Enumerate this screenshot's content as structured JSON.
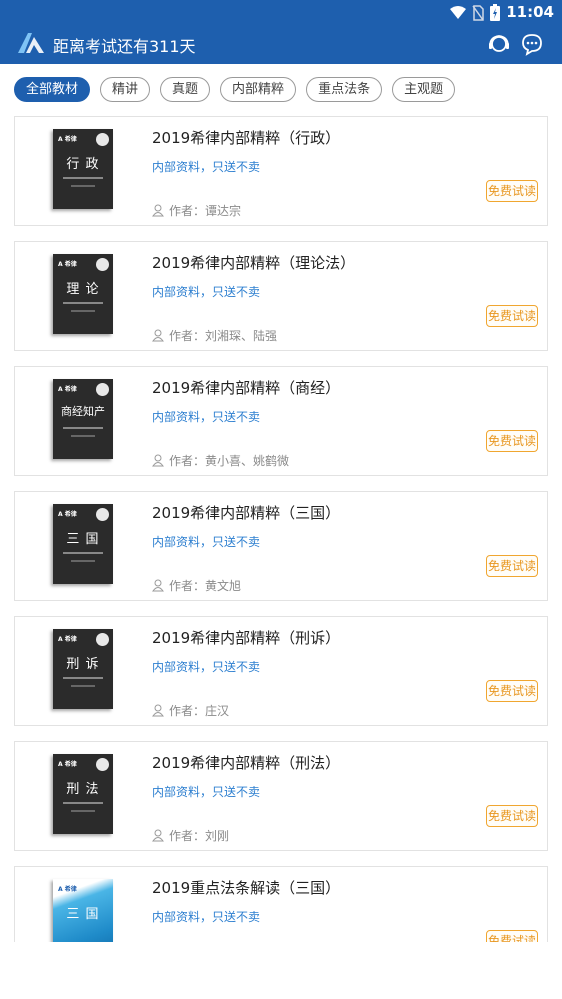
{
  "status_bar": {
    "time": "11:04"
  },
  "app_bar": {
    "title": "距离考试还有311天"
  },
  "tabs": [
    {
      "label": "全部教材",
      "active": true
    },
    {
      "label": "精讲",
      "active": false
    },
    {
      "label": "真题",
      "active": false
    },
    {
      "label": "内部精粹",
      "active": false
    },
    {
      "label": "重点法条",
      "active": false
    },
    {
      "label": "主观题",
      "active": false
    }
  ],
  "books": [
    {
      "title": "2019希律内部精粹（行政）",
      "subtitle": "内部资料，只送不卖",
      "author": "作者：谭达宗",
      "cover_text": "行 政",
      "cover_style": "dark",
      "action": "免费试读"
    },
    {
      "title": "2019希律内部精粹（理论法）",
      "subtitle": "内部资料，只送不卖",
      "author": "作者：刘湘琛、陆强",
      "cover_text": "理 论",
      "cover_style": "dark",
      "action": "免费试读"
    },
    {
      "title": "2019希律内部精粹（商经）",
      "subtitle": "内部资料，只送不卖",
      "author": "作者：黄小喜、姚鹤微",
      "cover_text": "商经知产",
      "cover_style": "dark",
      "action": "免费试读"
    },
    {
      "title": "2019希律内部精粹（三国）",
      "subtitle": "内部资料，只送不卖",
      "author": "作者：黄文旭",
      "cover_text": "三 国",
      "cover_style": "dark",
      "action": "免费试读"
    },
    {
      "title": "2019希律内部精粹（刑诉）",
      "subtitle": "内部资料，只送不卖",
      "author": "作者：庄汉",
      "cover_text": "刑 诉",
      "cover_style": "dark",
      "action": "免费试读"
    },
    {
      "title": "2019希律内部精粹（刑法）",
      "subtitle": "内部资料，只送不卖",
      "author": "作者：刘刚",
      "cover_text": "刑 法",
      "cover_style": "dark",
      "action": "免费试读"
    },
    {
      "title": "2019重点法条解读（三国）",
      "subtitle": "内部资料，只送不卖",
      "author": "",
      "cover_text": "三 国",
      "cover_style": "blue",
      "action": "免费试读"
    }
  ],
  "colors": {
    "primary": "#1e5fae",
    "link": "#2d7fd0",
    "trial": "#f0a630"
  }
}
